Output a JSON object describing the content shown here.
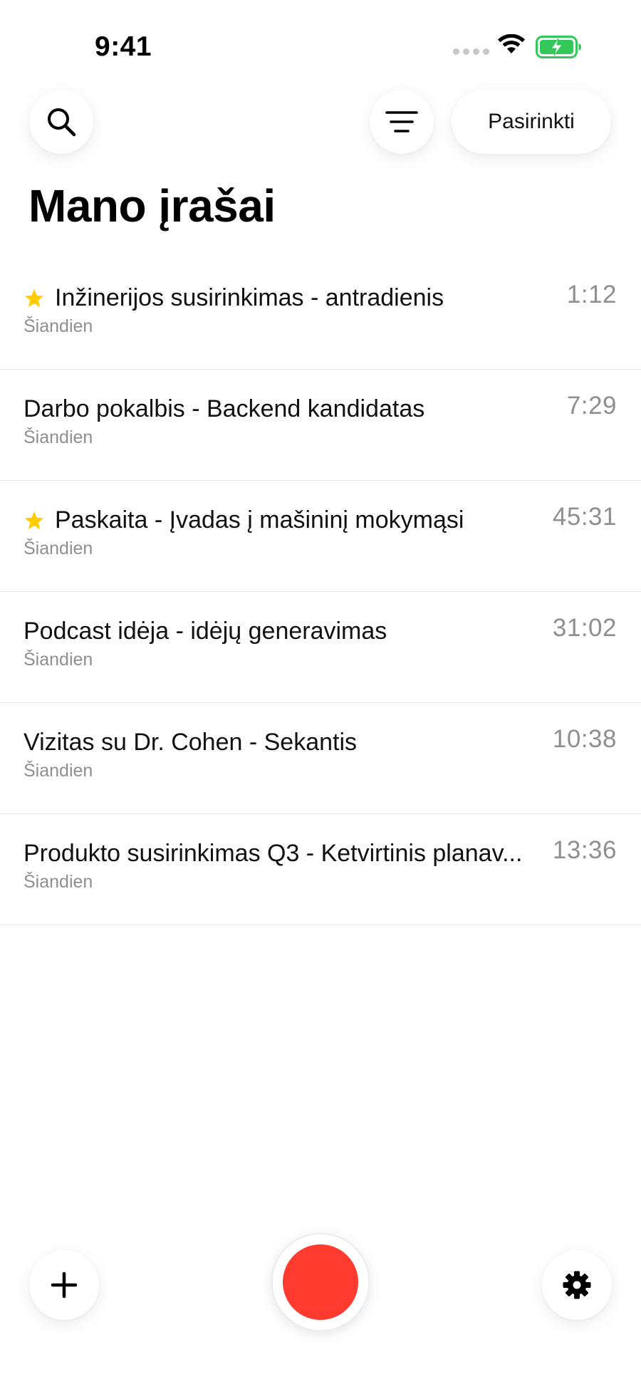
{
  "status_bar": {
    "time": "9:41",
    "icons": [
      "signal-dots-icon",
      "wifi-icon",
      "battery-charging-icon"
    ],
    "battery_color": "#34c759"
  },
  "header": {
    "search_icon": "search-icon",
    "filter_icon": "filter-icon",
    "select_label": "Pasirinkti"
  },
  "page_title": "Mano įrašai",
  "recordings": [
    {
      "title": "Inžinerijos susirinkimas - antradienis",
      "date": "Šiandien",
      "duration": "1:12",
      "starred": true
    },
    {
      "title": "Darbo pokalbis - Backend kandidatas",
      "date": "Šiandien",
      "duration": "7:29",
      "starred": false
    },
    {
      "title": "Paskaita - Įvadas į mašininį mokymąsi",
      "date": "Šiandien",
      "duration": "45:31",
      "starred": true
    },
    {
      "title": "Podcast idėja - idėjų generavimas",
      "date": "Šiandien",
      "duration": "31:02",
      "starred": false
    },
    {
      "title": "Vizitas su Dr. Cohen - Sekantis",
      "date": "Šiandien",
      "duration": "10:38",
      "starred": false
    },
    {
      "title": "Produkto susirinkimas Q3 - Ketvirtinis planav...",
      "date": "Šiandien",
      "duration": "13:36",
      "starred": false
    }
  ],
  "bottom_bar": {
    "add_icon": "plus-icon",
    "record_icon": "record-icon",
    "settings_icon": "gear-icon"
  },
  "colors": {
    "accent_record": "#ff3b30",
    "star": "#ffcc00",
    "secondary_text": "#8e8e93",
    "divider": "#e6e6e8"
  }
}
